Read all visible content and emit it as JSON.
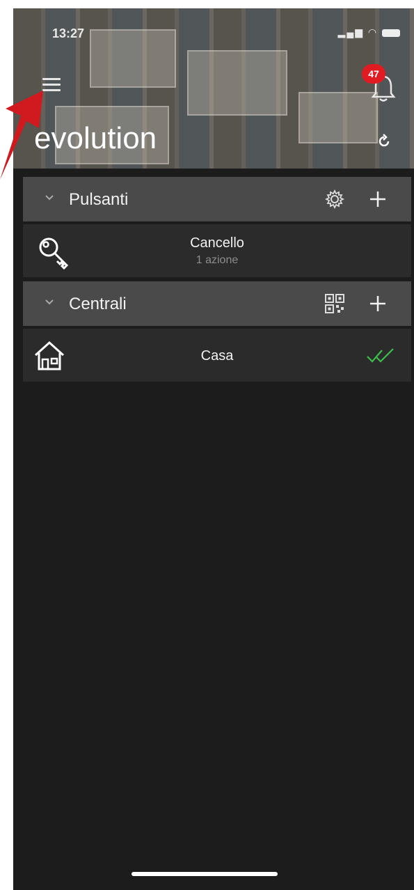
{
  "status_bar": {
    "time": "13:27"
  },
  "header": {
    "title": "evolution",
    "notifications_count": "47"
  },
  "sections": [
    {
      "label": "Pulsanti",
      "tools": [
        "gear-icon",
        "plus-icon"
      ],
      "items": [
        {
          "name": "Cancello",
          "subtitle": "1 azione",
          "icon": "key-icon"
        }
      ]
    },
    {
      "label": "Centrali",
      "tools": [
        "qr-code-icon",
        "plus-icon"
      ],
      "items": [
        {
          "name": "Casa",
          "icon": "house-icon",
          "status_icon": "double-check-icon"
        }
      ]
    }
  ],
  "colors": {
    "background": "#1c1c1c",
    "section_bar": "#4a4a4a",
    "row": "#2b2b2b",
    "badge": "#e11b22",
    "status_ok": "#3bbf4a",
    "pointer_arrow": "#d11a1f"
  }
}
